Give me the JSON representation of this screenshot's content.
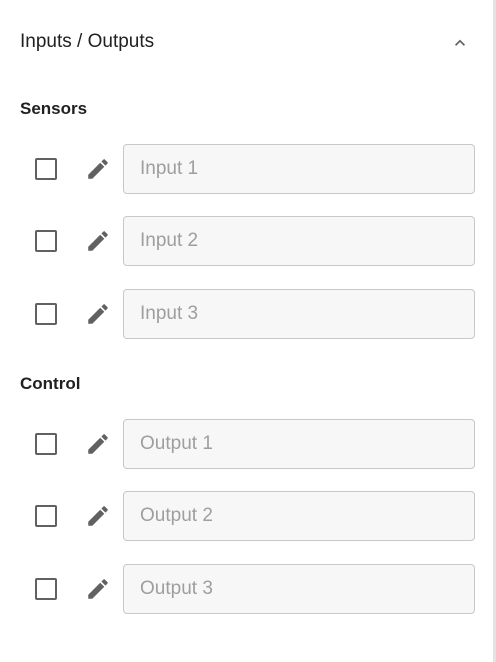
{
  "header": {
    "title": "Inputs / Outputs",
    "collapse_icon": "chevron-up-icon"
  },
  "sections": [
    {
      "title": "Sensors",
      "rows": [
        {
          "checked": false,
          "edit_icon": "pencil-icon",
          "value": "",
          "placeholder": "Input 1"
        },
        {
          "checked": false,
          "edit_icon": "pencil-icon",
          "value": "",
          "placeholder": "Input 2"
        },
        {
          "checked": false,
          "edit_icon": "pencil-icon",
          "value": "",
          "placeholder": "Input 3"
        }
      ]
    },
    {
      "title": "Control",
      "rows": [
        {
          "checked": false,
          "edit_icon": "pencil-icon",
          "value": "",
          "placeholder": "Output 1"
        },
        {
          "checked": false,
          "edit_icon": "pencil-icon",
          "value": "",
          "placeholder": "Output 2"
        },
        {
          "checked": false,
          "edit_icon": "pencil-icon",
          "value": "",
          "placeholder": "Output 3"
        }
      ]
    }
  ],
  "colors": {
    "text": "#212121",
    "icon": "#616161",
    "placeholder": "#9e9e9e",
    "field_background": "#f7f7f7",
    "field_border": "#c8c8c8"
  }
}
